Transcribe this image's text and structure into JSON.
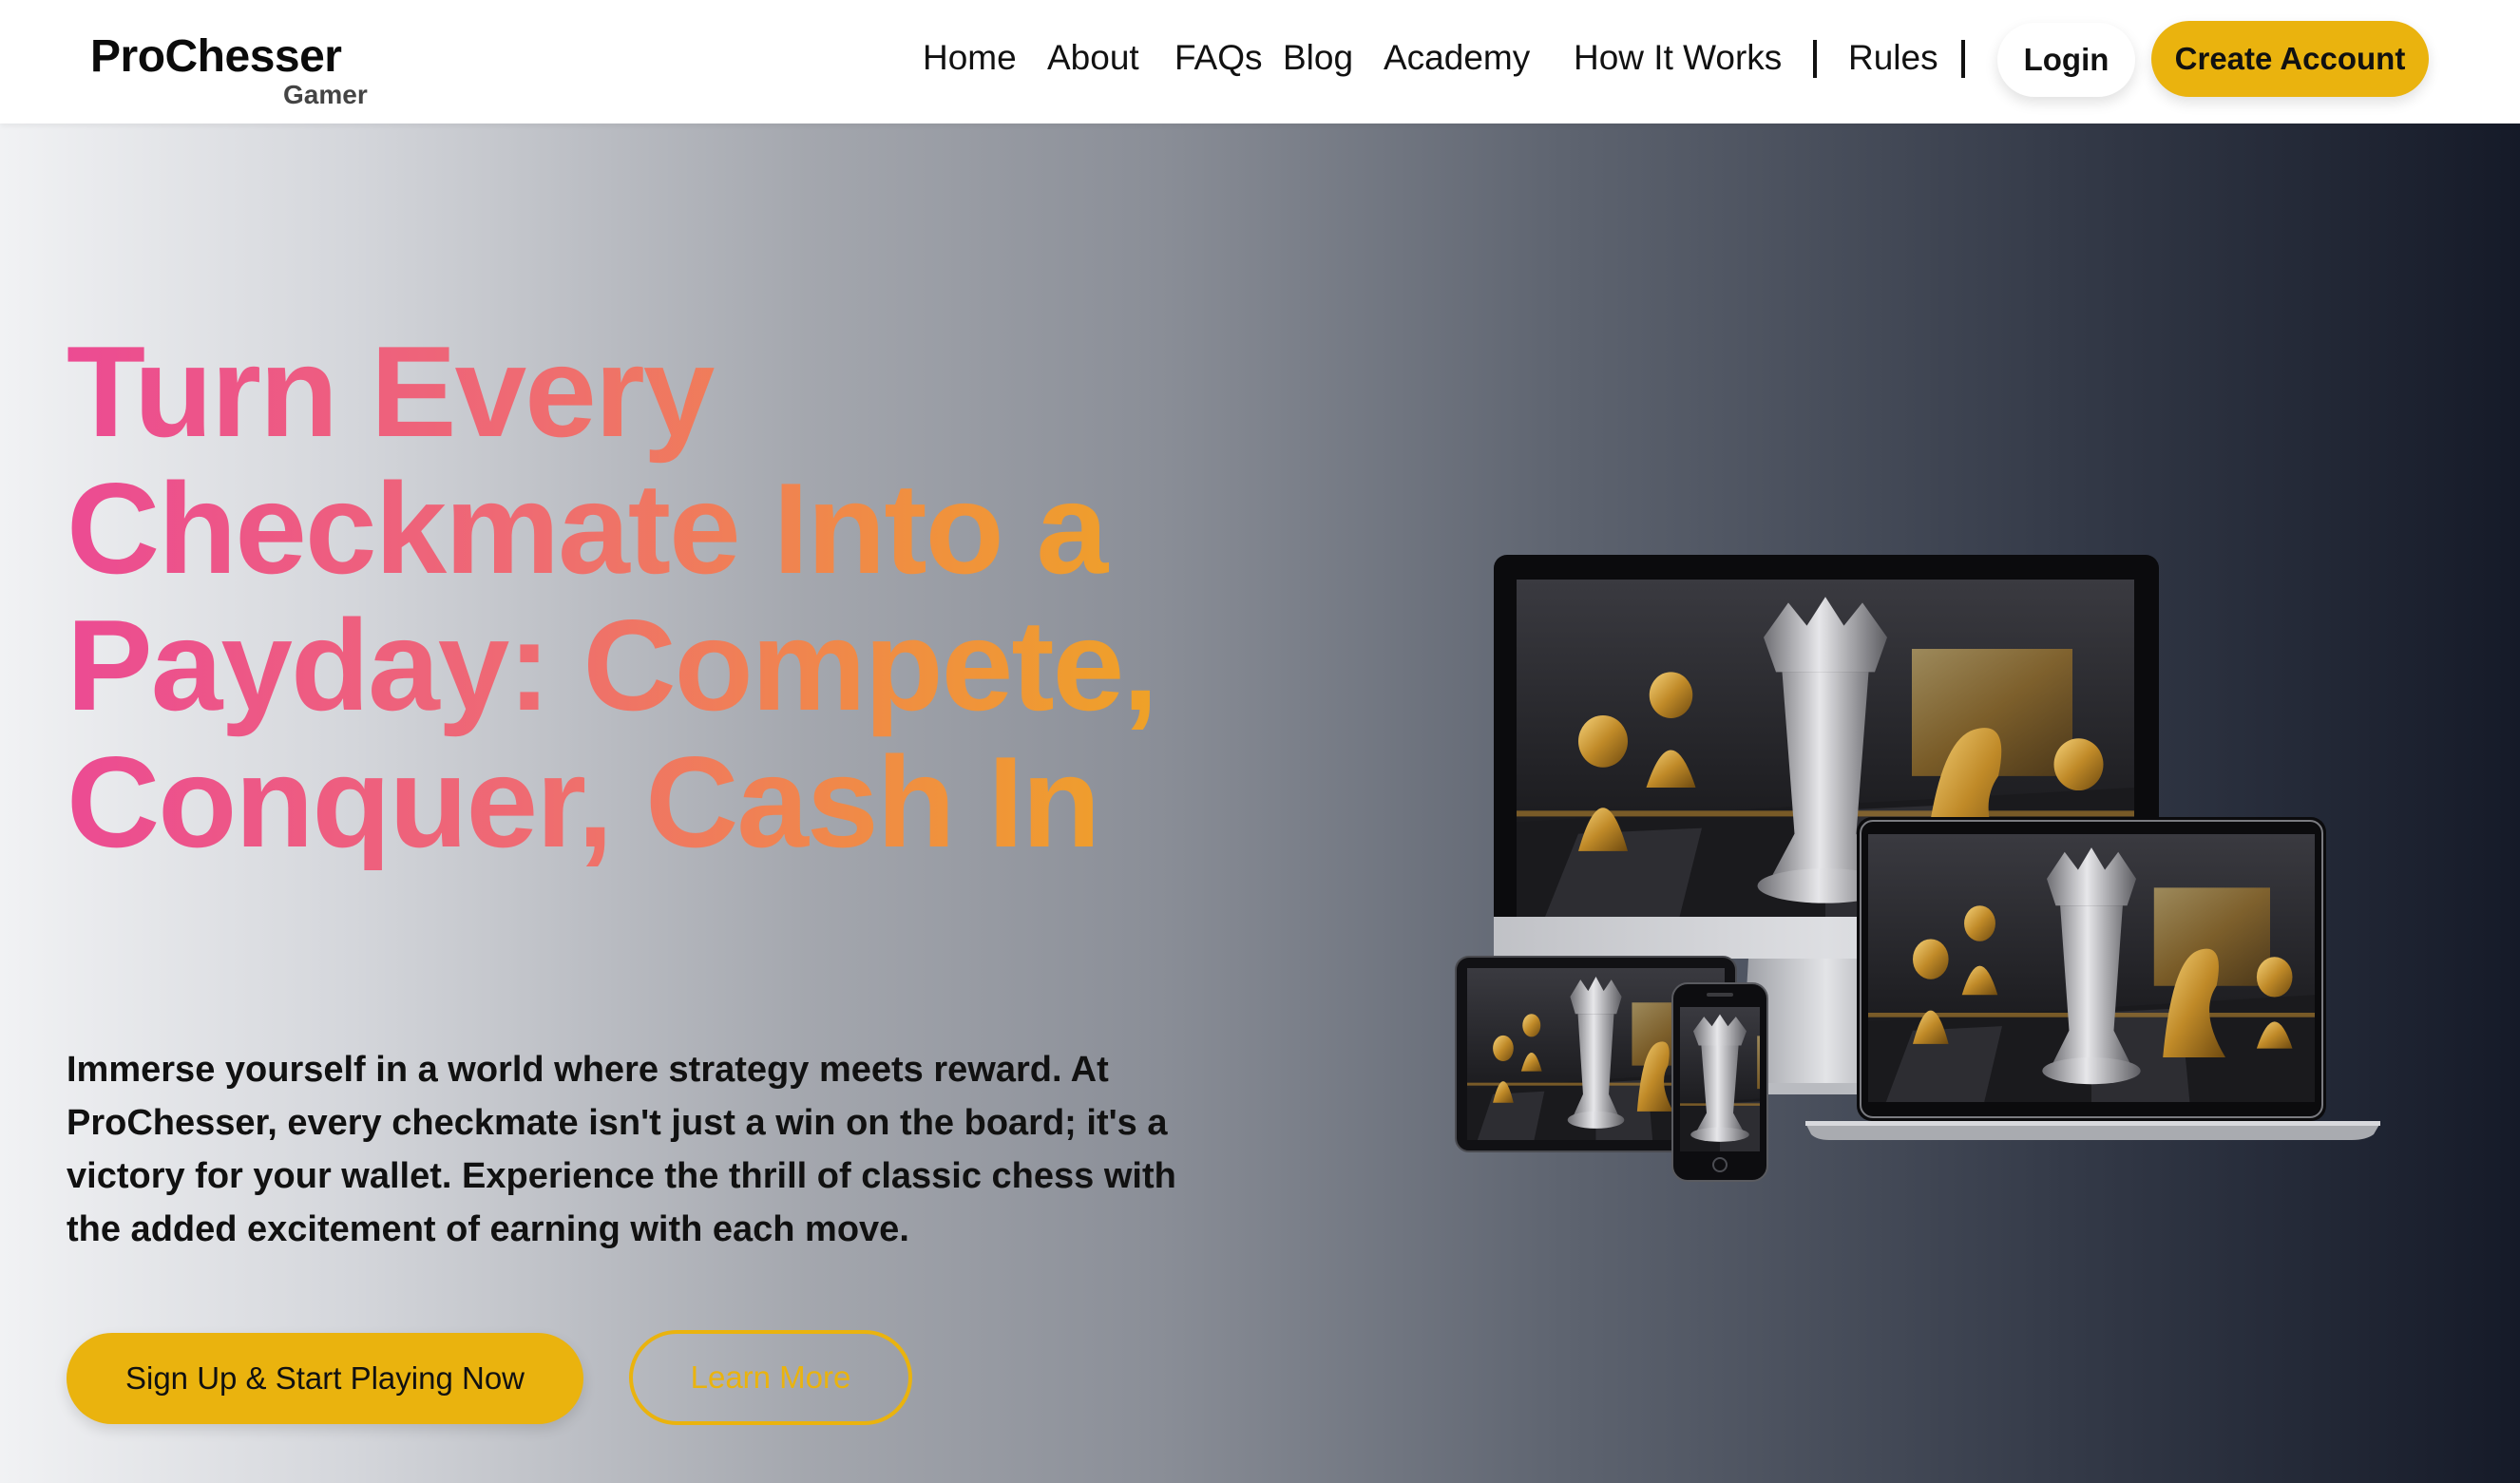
{
  "header": {
    "logo_title": "ProChesser",
    "logo_subtitle": "Gamer",
    "nav": [
      "Home",
      "About",
      "FAQs",
      "Blog",
      "Academy",
      "How It Works",
      "Rules"
    ],
    "login_label": "Login",
    "create_account_label": "Create Account"
  },
  "hero": {
    "headline": "Turn Every Checkmate Into a Payday: Compete, Conquer, Cash In",
    "description": "Immerse yourself in a world where strategy meets reward. At ProChesser, every checkmate isn't just a win on the board; it's a victory for your wallet. Experience the thrill of classic chess with the added excitement of earning with each move.",
    "primary_cta": "Sign Up & Start Playing Now",
    "secondary_cta": "Learn More"
  },
  "colors": {
    "accent": "#eab30e",
    "headline_gradient": [
      "#ec4b93",
      "#f0903f",
      "#eeab1b"
    ],
    "hero_gradient_start": "#f1f2f4",
    "hero_gradient_end": "#151a28"
  },
  "illustration": {
    "description_icon": "devices-chess-illustration"
  }
}
